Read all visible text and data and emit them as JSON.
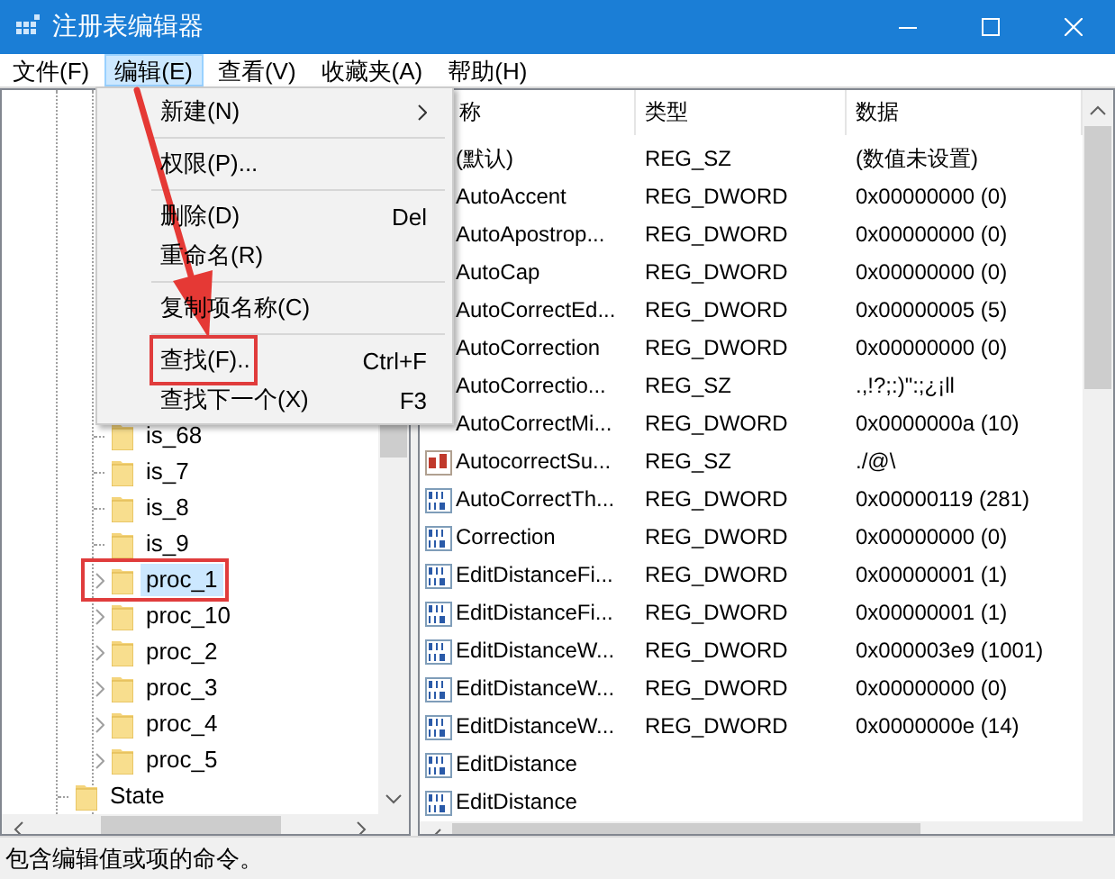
{
  "window": {
    "title": "注册表编辑器"
  },
  "menubar": [
    {
      "label": "文件(F)",
      "selected": false
    },
    {
      "label": "编辑(E)",
      "selected": true
    },
    {
      "label": "查看(V)",
      "selected": false
    },
    {
      "label": "收藏夹(A)",
      "selected": false
    },
    {
      "label": "帮助(H)",
      "selected": false
    }
  ],
  "edit_menu": [
    {
      "kind": "item",
      "label": "新建(N)",
      "submenu": true
    },
    {
      "kind": "separator"
    },
    {
      "kind": "item",
      "label": "权限(P)..."
    },
    {
      "kind": "separator"
    },
    {
      "kind": "item",
      "label": "删除(D)",
      "shortcut": "Del"
    },
    {
      "kind": "item",
      "label": "重命名(R)"
    },
    {
      "kind": "separator"
    },
    {
      "kind": "item",
      "label": "复制项名称(C)"
    },
    {
      "kind": "separator"
    },
    {
      "kind": "item",
      "label": "查找(F)..",
      "shortcut": "Ctrl+F",
      "annotated": true
    },
    {
      "kind": "item",
      "label": "查找下一个(X)",
      "shortcut": "F3"
    }
  ],
  "callout_arrow": true,
  "tree": [
    {
      "children": [
        {
          "label": "is_68",
          "selected": false
        },
        {
          "label": "is_7",
          "selected": false
        },
        {
          "label": "is_8",
          "selected": false
        },
        {
          "label": "is_9",
          "selected": false
        },
        {
          "label": "proc_1",
          "selected": true,
          "expandable": true,
          "annotated": true
        },
        {
          "label": "proc_10",
          "selected": false,
          "expandable": true
        },
        {
          "label": "proc_2",
          "selected": false,
          "expandable": true
        },
        {
          "label": "proc_3",
          "selected": false,
          "expandable": true
        },
        {
          "label": "proc_4",
          "selected": false,
          "expandable": true
        },
        {
          "label": "proc_5",
          "selected": false,
          "expandable": true
        }
      ]
    },
    {
      "label": "State",
      "selected": false
    }
  ],
  "table": {
    "columns": [
      "称",
      "类型",
      "数据"
    ],
    "rows": [
      {
        "name": "(默认)",
        "type": "REG_SZ",
        "data": "(数值未设置)"
      },
      {
        "name": "AutoAccent",
        "type": "REG_DWORD",
        "data": "0x00000000 (0)"
      },
      {
        "name": "AutoApostrop...",
        "type": "REG_DWORD",
        "data": "0x00000000 (0)"
      },
      {
        "name": "AutoCap",
        "type": "REG_DWORD",
        "data": "0x00000000 (0)"
      },
      {
        "name": "AutoCorrectEd...",
        "type": "REG_DWORD",
        "data": "0x00000005 (5)"
      },
      {
        "name": "AutoCorrection",
        "type": "REG_DWORD",
        "data": "0x00000000 (0)"
      },
      {
        "name": "AutoCorrectio...",
        "type": "REG_SZ",
        "data": ".,!?;:)\":;¿¡ll"
      },
      {
        "name": "AutoCorrectMi...",
        "type": "REG_DWORD",
        "data": "0x0000000a (10)"
      },
      {
        "name": "AutocorrectSu...",
        "type": "REG_SZ",
        "data": "./@\\",
        "kind": "string"
      },
      {
        "name": "AutoCorrectTh...",
        "type": "REG_DWORD",
        "data": "0x00000119 (281)",
        "kind": "dword"
      },
      {
        "name": "Correction",
        "type": "REG_DWORD",
        "data": "0x00000000 (0)",
        "kind": "dword"
      },
      {
        "name": "EditDistanceFi...",
        "type": "REG_DWORD",
        "data": "0x00000001 (1)",
        "kind": "dword"
      },
      {
        "name": "EditDistanceFi...",
        "type": "REG_DWORD",
        "data": "0x00000001 (1)",
        "kind": "dword"
      },
      {
        "name": "EditDistanceW...",
        "type": "REG_DWORD",
        "data": "0x000003e9 (1001)",
        "kind": "dword"
      },
      {
        "name": "EditDistanceW...",
        "type": "REG_DWORD",
        "data": "0x00000000 (0)",
        "kind": "dword"
      },
      {
        "name": "EditDistanceW...",
        "type": "REG_DWORD",
        "data": "0x0000000e (14)",
        "kind": "dword"
      },
      {
        "name": "EditDistance",
        "kind": "dword"
      },
      {
        "name": "EditDistance",
        "kind": "dword"
      }
    ]
  },
  "status_bar": "包含编辑值或项的命令。"
}
